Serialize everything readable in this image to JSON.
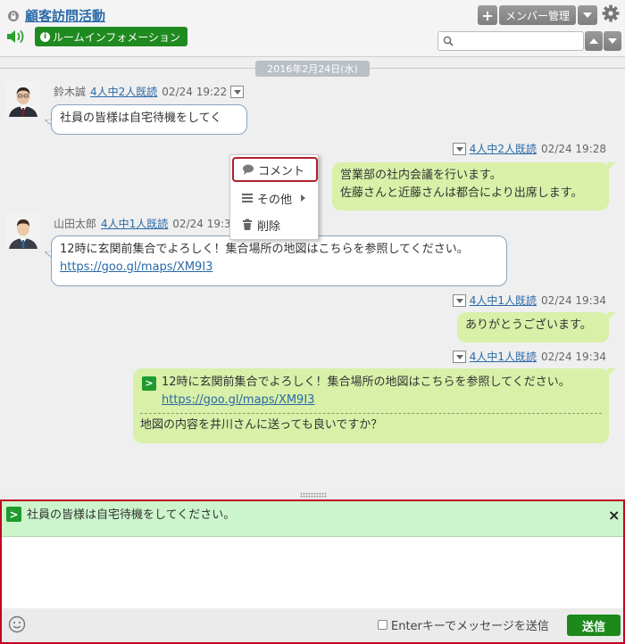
{
  "header": {
    "room_title": "顧客訪問活動",
    "info_button": "ルームインフォメーション",
    "plus_label": "+",
    "member_button": "メンバー管理",
    "search_placeholder": ""
  },
  "date_separator": "2016年2月24日(水)",
  "messages": [
    {
      "sender": "鈴木誠",
      "read_status": "4人中2人既読",
      "time": "02/24 19:22",
      "text": "社員の皆様は自宅待機をしてく"
    },
    {
      "sender": "",
      "read_status": "4人中2人既読",
      "time": "02/24 19:28",
      "line1": "営業部の社内会議を行います。",
      "line2": "佐藤さんと近藤さんは都合により出席します。"
    },
    {
      "sender": "山田太郎",
      "read_status": "4人中1人既読",
      "time": "02/24 19:33",
      "text": "12時に玄関前集合でよろしく！集合場所の地図はこちらを参照してください。",
      "link": "https://goo.gl/maps/XM9I3"
    },
    {
      "sender": "",
      "read_status": "4人中1人既読",
      "time": "02/24 19:34",
      "text": "ありがとうございます。"
    },
    {
      "sender": "",
      "read_status": "4人中1人既読",
      "time": "02/24 19:34",
      "quote_text": "12時に玄関前集合でよろしく！集合場所の地図はこちらを参照してください。",
      "quote_link": "https://goo.gl/maps/XM9I3",
      "text": "地図の内容を井川さんに送っても良いですか？"
    }
  ],
  "context_menu": {
    "comment": "コメント",
    "other": "その他",
    "delete": "削除"
  },
  "composer": {
    "quote_icon": ">",
    "quoted_text": "社員の皆様は自宅待機をしてください。",
    "close": "×",
    "input_value": "",
    "enter_to_send_label": "Enterキーでメッセージを送信",
    "send_button": "送信"
  },
  "colors": {
    "accent_green": "#1f8a1f",
    "link_blue": "#2a6aa8",
    "my_bubble": "#d8f0a8",
    "highlight_red": "#c00020"
  }
}
